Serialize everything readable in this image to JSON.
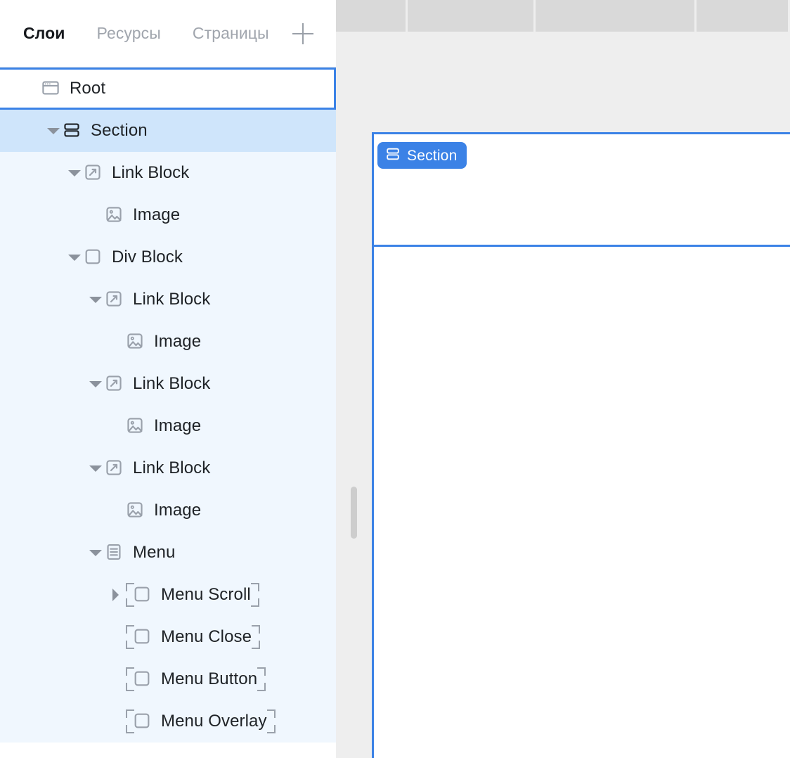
{
  "panel": {
    "tabs": [
      {
        "label": "Слои",
        "active": true,
        "name": "tab-layers"
      },
      {
        "label": "Ресурсы",
        "active": false,
        "name": "tab-assets"
      },
      {
        "label": "Страницы",
        "active": false,
        "name": "tab-pages"
      }
    ],
    "add_tab_icon": "plus-icon"
  },
  "tree": {
    "rows": [
      {
        "label": "Root",
        "icon": "browser-window-icon",
        "caret": "none",
        "indent": 0,
        "state": "outlined",
        "component": false
      },
      {
        "label": "Section",
        "icon": "section-icon",
        "caret": "down",
        "indent": 1,
        "state": "selected",
        "component": false
      },
      {
        "label": "Link Block",
        "icon": "link-block-icon",
        "caret": "down",
        "indent": 2,
        "state": "tint",
        "component": false
      },
      {
        "label": "Image",
        "icon": "image-icon",
        "caret": "none",
        "indent": 3,
        "state": "tint",
        "component": false
      },
      {
        "label": "Div Block",
        "icon": "div-block-icon",
        "caret": "down",
        "indent": 2,
        "state": "tint",
        "component": false
      },
      {
        "label": "Link Block",
        "icon": "link-block-icon",
        "caret": "down",
        "indent": 3,
        "state": "tint",
        "component": false
      },
      {
        "label": "Image",
        "icon": "image-icon",
        "caret": "none",
        "indent": 4,
        "state": "tint",
        "component": false
      },
      {
        "label": "Link Block",
        "icon": "link-block-icon",
        "caret": "down",
        "indent": 3,
        "state": "tint",
        "component": false
      },
      {
        "label": "Image",
        "icon": "image-icon",
        "caret": "none",
        "indent": 4,
        "state": "tint",
        "component": false
      },
      {
        "label": "Link Block",
        "icon": "link-block-icon",
        "caret": "down",
        "indent": 3,
        "state": "tint",
        "component": false
      },
      {
        "label": "Image",
        "icon": "image-icon",
        "caret": "none",
        "indent": 4,
        "state": "tint",
        "component": false
      },
      {
        "label": "Menu",
        "icon": "menu-list-icon",
        "caret": "down",
        "indent": 3,
        "state": "tint",
        "component": false
      },
      {
        "label": "Menu Scroll",
        "icon": "div-block-icon",
        "caret": "right",
        "indent": 4,
        "state": "tint",
        "component": true
      },
      {
        "label": "Menu Close",
        "icon": "div-block-icon",
        "caret": "none",
        "indent": 4,
        "state": "tint",
        "component": true
      },
      {
        "label": "Menu Button",
        "icon": "div-block-icon",
        "caret": "none",
        "indent": 4,
        "state": "tint",
        "component": true
      },
      {
        "label": "Menu Overlay",
        "icon": "div-block-icon",
        "caret": "none",
        "indent": 4,
        "state": "tint",
        "component": true
      }
    ]
  },
  "canvas": {
    "top_strip_segments": [
      100,
      180,
      228,
      131
    ],
    "section_badge": {
      "label": "Section",
      "icon": "section-icon"
    },
    "scrollbar": "vertical-scrollbar-thumb"
  },
  "colors": {
    "accent": "#3b82e6",
    "selected_row": "#cfe5fb",
    "tint_row": "#f0f7fe",
    "icon_gray": "#9aa1ab",
    "canvas_bg": "#eeeeee",
    "strip_gray": "#d9d9d9"
  }
}
